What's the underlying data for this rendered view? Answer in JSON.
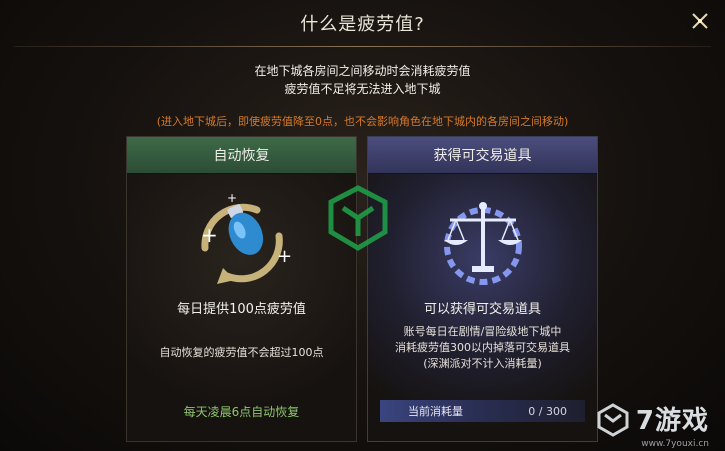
{
  "header": {
    "title": "什么是疲劳值?"
  },
  "description": {
    "line1": "在地下城各房间之间移动时会消耗疲劳值",
    "line2": "疲劳值不足将无法进入地下城",
    "note": "(进入地下城后，即使疲劳值降至0点，也不会影响角色在地下城内的各房间之间移动)"
  },
  "cards": {
    "auto_recover": {
      "title": "自动恢复",
      "line1": "每日提供100点疲劳值",
      "line2": "自动恢复的疲劳值不会超过100点",
      "line3": "每天凌晨6点自动恢复"
    },
    "tradeable": {
      "title": "获得可交易道具",
      "line1": "可以获得可交易道具",
      "line2": "账号每日在剧情/冒险级地下城中",
      "line3": "消耗疲劳值300以内掉落可交易道具",
      "line4": "(深渊派对不计入消耗量)",
      "progress_label": "当前消耗量",
      "progress_value": "0 / 300"
    }
  },
  "brand": {
    "name": "7游戏",
    "url": "www.7youxi.cn"
  },
  "icons": [
    "close-icon",
    "potion-recover-icon",
    "scales-gear-icon",
    "watermark-logo-icon"
  ]
}
